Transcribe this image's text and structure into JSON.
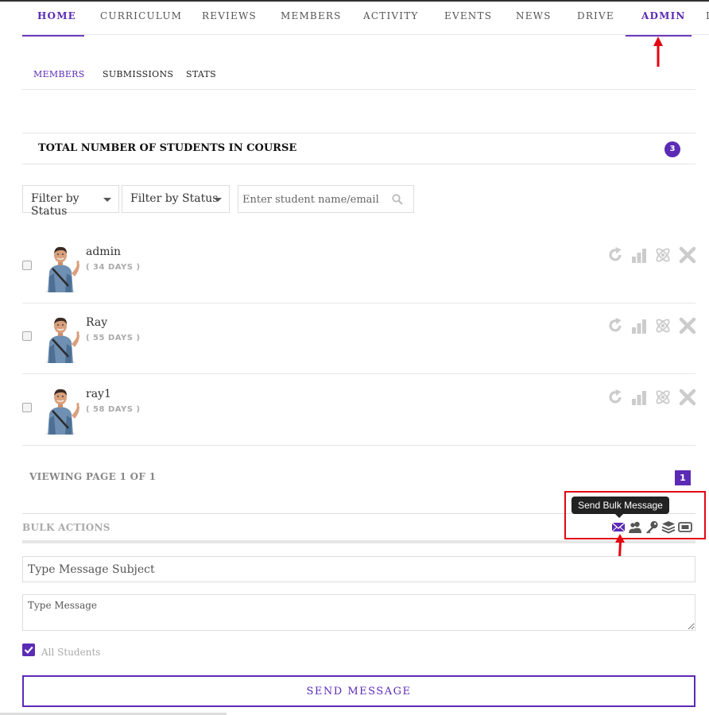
{
  "nav": {
    "items": [
      {
        "label": "HOME",
        "active": true
      },
      {
        "label": "CURRICULUM",
        "active": false
      },
      {
        "label": "REVIEWS",
        "active": false
      },
      {
        "label": "MEMBERS",
        "active": false
      },
      {
        "label": "ACTIVITY",
        "active": false
      },
      {
        "label": "EVENTS",
        "active": false
      },
      {
        "label": "NEWS",
        "active": false
      },
      {
        "label": "DRIVE",
        "active": false
      },
      {
        "label": "ADMIN",
        "active": true
      }
    ]
  },
  "subnav": {
    "items": [
      {
        "label": "MEMBERS",
        "active": true
      },
      {
        "label": "SUBMISSIONS",
        "active": false
      },
      {
        "label": "STATS",
        "active": false
      }
    ]
  },
  "total": {
    "label": "TOTAL NUMBER OF STUDENTS IN COURSE",
    "count": "3"
  },
  "filters": {
    "status_1": "Filter by Status",
    "status_2": "Filter by Status",
    "search_placeholder": "Enter student name/email"
  },
  "members": [
    {
      "name": "admin",
      "days": "( 34 DAYS )"
    },
    {
      "name": "Ray",
      "days": "( 55 DAYS )"
    },
    {
      "name": "ray1",
      "days": "( 58 DAYS )"
    }
  ],
  "member_action_icons": [
    "reset-icon",
    "stats-bars-icon",
    "atom-icon",
    "remove-x-icon"
  ],
  "pager": {
    "text": "VIEWING PAGE 1 OF 1",
    "current_page": "1"
  },
  "bulk": {
    "label": "BULK ACTIONS",
    "tooltip": "Send Bulk Message",
    "icons": [
      "envelope-icon",
      "users-icon",
      "key-icon",
      "layers-icon",
      "certificate-icon"
    ]
  },
  "message_form": {
    "subject_placeholder": "Type Message Subject",
    "message_placeholder": "Type Message",
    "all_students_label": "All Students",
    "all_students_checked": true,
    "send_label": "SEND MESSAGE"
  },
  "colors": {
    "accent": "#5b2bb5",
    "annotation": "#e30613"
  }
}
